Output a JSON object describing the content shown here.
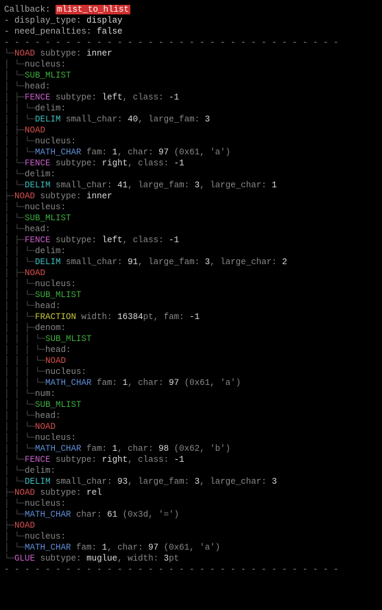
{
  "header": {
    "callback_label": "Callback: ",
    "callback_value": "mlist_to_hlist",
    "display_type_label": "- display_type: ",
    "display_type_value": "display",
    "need_penalties_label": "- need_penalties: ",
    "need_penalties_value": "false",
    "rule": "- - - - - - - - - - - - - - - - - - - - - - - - - - - - - - - - -"
  },
  "kw": {
    "NOAD": "NOAD",
    "subtype": "subtype:",
    "inner": "inner",
    "rel": "rel",
    "nucleus": "nucleus:",
    "SUB_MLIST": "SUB_MLIST",
    "head": "head:",
    "FENCE": "FENCE",
    "left": "left",
    "right": "right",
    "class": "class:",
    "neg1": "-1",
    "delim": "delim:",
    "DELIM": "DELIM",
    "small_char": "small_char:",
    "large_fam": "large_fam:",
    "large_char": "large_char:",
    "MATH_CHAR": "MATH_CHAR",
    "fam": "fam:",
    "char": "char:",
    "FRACTION": "FRACTION",
    "width": "width:",
    "pt": "pt",
    "denom": "denom:",
    "num": "num:",
    "GLUE": "GLUE",
    "muglue": "muglue"
  },
  "vals": {
    "sc40": "40",
    "sc41": "41",
    "sc91": "91",
    "sc93": "93",
    "lf3": "3",
    "lc1": "1",
    "lc2": "2",
    "lc3": "3",
    "fam1": "1",
    "char97": "97",
    "char97_paren": "(0x61, 'a')",
    "char98": "98",
    "char98_paren": "(0x62, 'b')",
    "char61": "61",
    "char61_paren": "(0x3d, '=')",
    "frac_width": "16384",
    "glue_width": "3"
  }
}
